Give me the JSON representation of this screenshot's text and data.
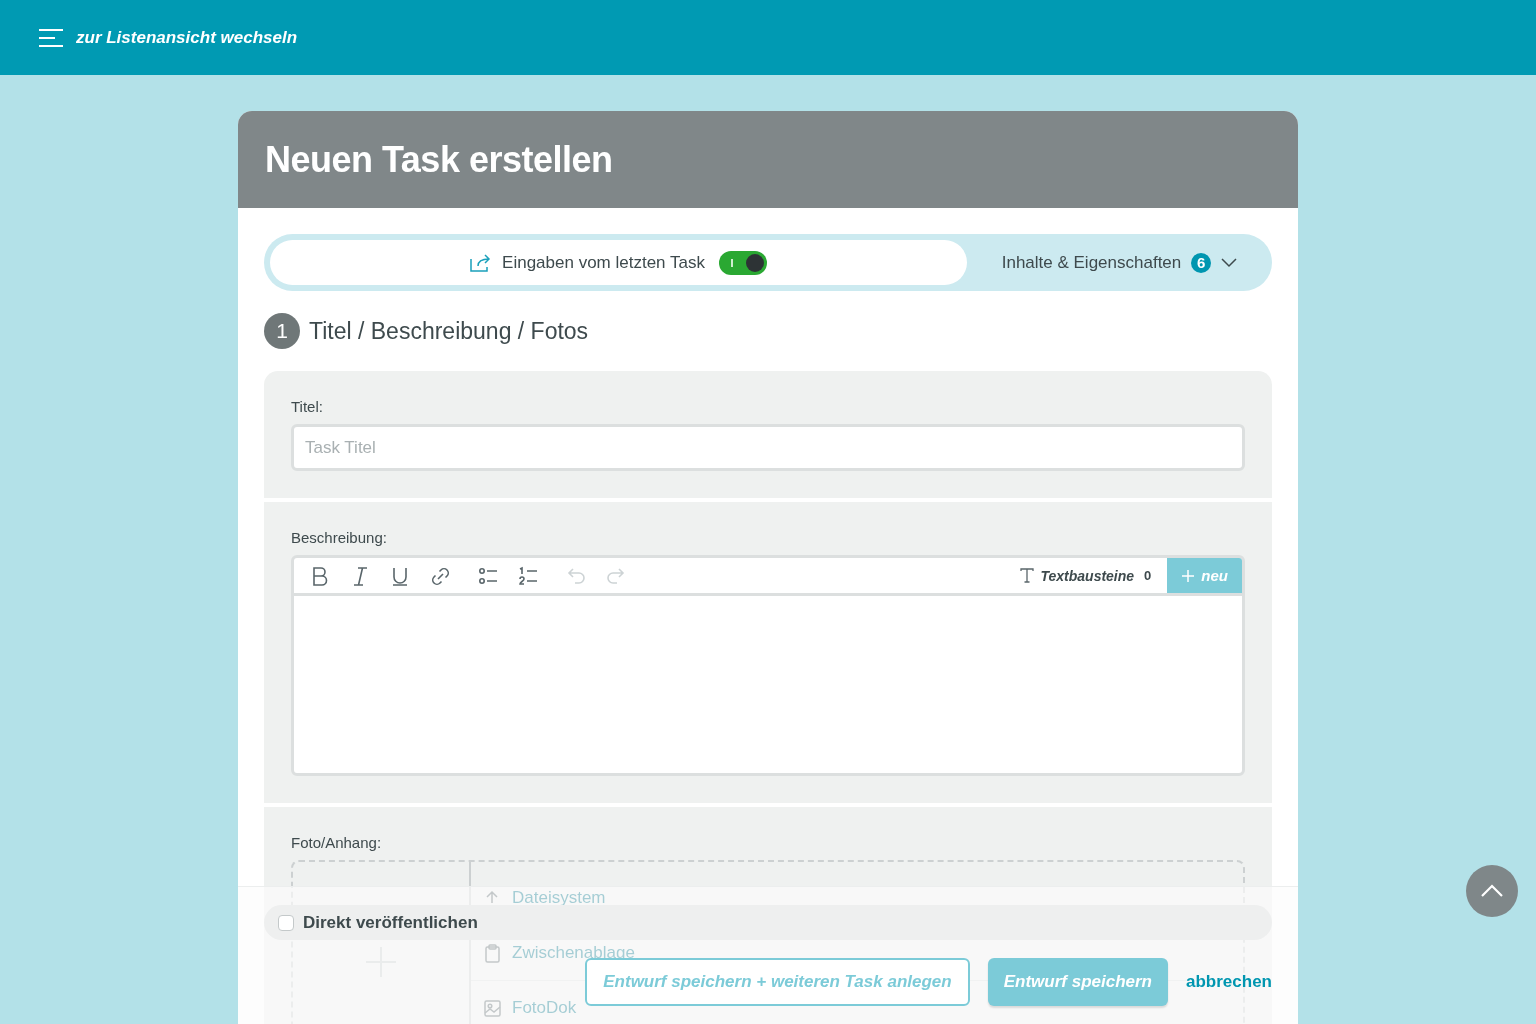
{
  "topbar": {
    "label": "zur Listenansicht wechseln"
  },
  "card": {
    "title": "Neuen Task erstellen"
  },
  "options_bar": {
    "reuse_label": "Eingaben vom letzten Task",
    "reuse_on": true,
    "contents_label": "Inhalte & Eigenschaften",
    "contents_count": "6",
    "expanded": false
  },
  "section": {
    "number": "1",
    "title": "Titel / Beschreibung / Fotos"
  },
  "title_field": {
    "label": "Titel:",
    "placeholder": "Task Titel"
  },
  "description": {
    "label": "Beschreibung:",
    "toolbar": [
      {
        "kind": "bold",
        "disabled": false
      },
      {
        "kind": "italic",
        "disabled": false
      },
      {
        "kind": "underline",
        "disabled": false
      },
      {
        "kind": "link",
        "disabled": false
      },
      {
        "kind": "bullets",
        "disabled": false
      },
      {
        "kind": "numbers",
        "disabled": false
      },
      {
        "kind": "undo",
        "disabled": true
      },
      {
        "kind": "redo",
        "disabled": true
      }
    ],
    "snippets_label": "Textbausteine",
    "snippets_count": "0",
    "new_label": "neu"
  },
  "attachment": {
    "label": "Foto/Anhang:",
    "sources": [
      {
        "kind": "upload",
        "label": "Dateisystem"
      },
      {
        "kind": "clipboard",
        "label": "Zwischenablage"
      },
      {
        "kind": "photo",
        "label": "FotoDok"
      }
    ]
  },
  "footer": {
    "publish_label": "Direkt veröffentlichen",
    "publish_checked": false,
    "buttons": [
      {
        "kind": "outline",
        "label": "Entwurf speichern + weiteren Task anlegen"
      },
      {
        "kind": "primary",
        "label": "Entwurf speichern"
      },
      {
        "kind": "link",
        "label": "abbrechen"
      }
    ]
  }
}
